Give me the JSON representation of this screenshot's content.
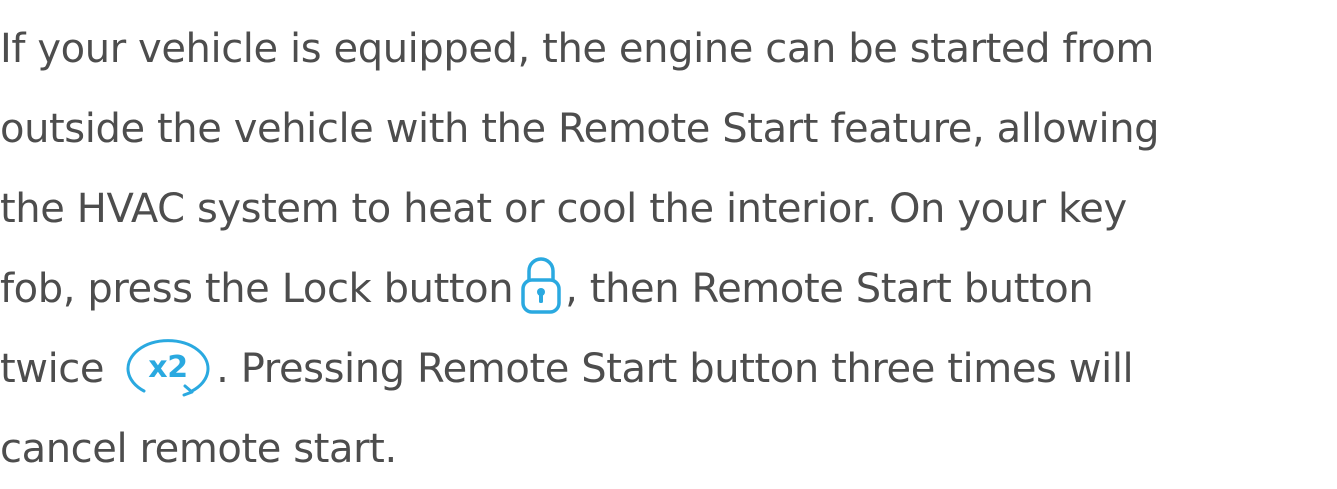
{
  "paragraph": {
    "line1": "If your vehicle is equipped, the engine can be started from",
    "line2": "outside the vehicle with the Remote Start feature, allowing",
    "line3": "the HVAC system to heat or cool the interior. On your key",
    "line4_before": "fob, press the Lock button",
    "line4_after": ", then Remote Start button",
    "line5_before": "twice",
    "line5_after": ". Pressing Remote Start button three times will",
    "line6": "cancel remote start."
  },
  "icons": {
    "lock": "lock-icon",
    "remote_start_x2": "remote-start-x2-icon",
    "remote_start_x2_label": "x2",
    "color": "#2aa9e0"
  },
  "colors": {
    "text": "#4d4d4d",
    "accent": "#2aa9e0"
  }
}
